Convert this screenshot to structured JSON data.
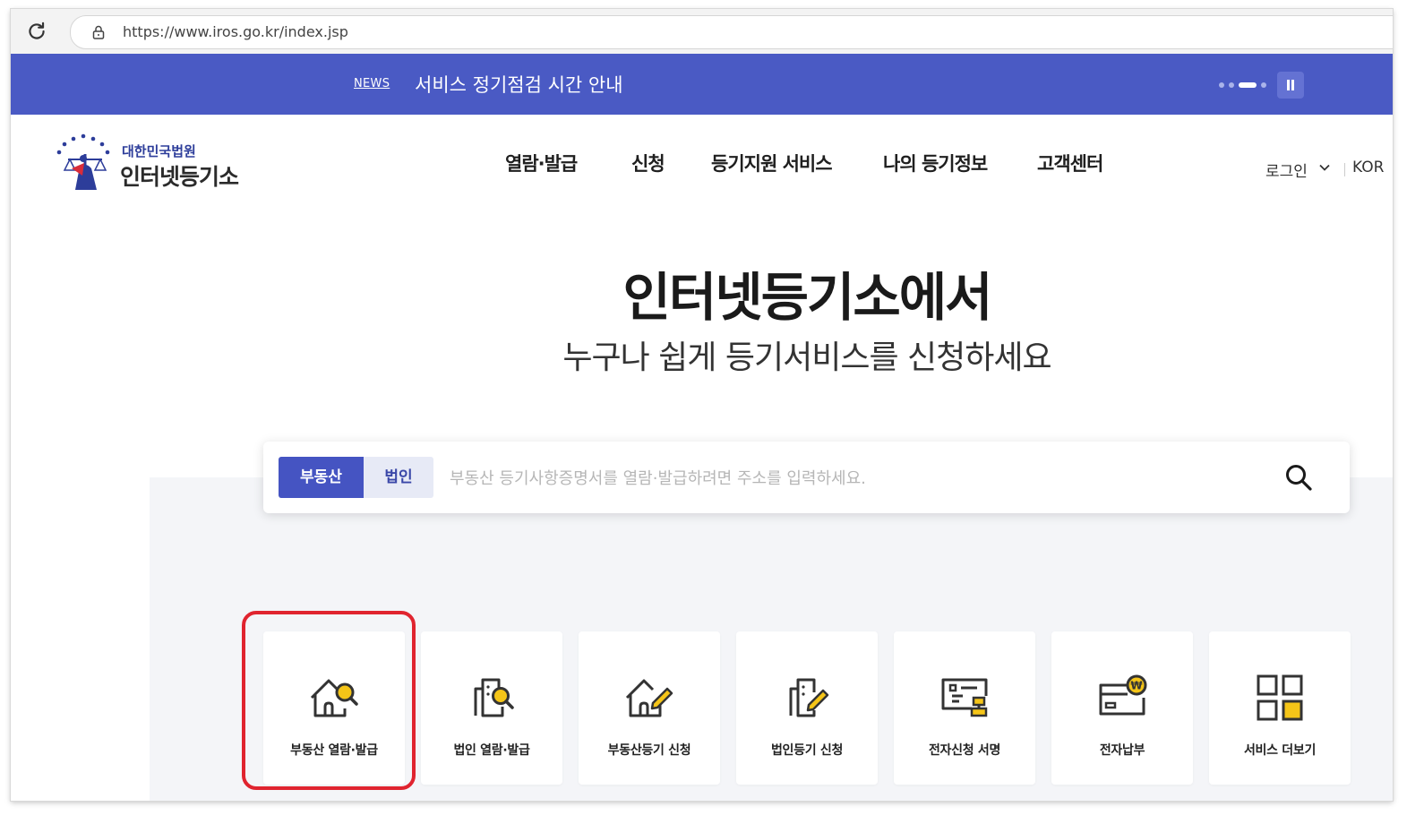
{
  "browser": {
    "url": "https://www.iros.go.kr/index.jsp"
  },
  "news": {
    "label": "NEWS",
    "text": "서비스 정기점검 시간 안내"
  },
  "header": {
    "logo_sub": "대한민국법원",
    "logo_main": "인터넷등기소",
    "nav": [
      "열람·발급",
      "신청",
      "등기지원 서비스",
      "나의 등기정보",
      "고객센터"
    ],
    "login": "로그인",
    "lang": "KOR"
  },
  "hero": {
    "title": "인터넷등기소에서",
    "subtitle": "누구나 쉽게 등기서비스를 신청하세요"
  },
  "search": {
    "tabs": [
      "부동산",
      "법인"
    ],
    "selected_tab": "부동산",
    "placeholder": "부동산 등기사항증명서를 열람·발급하려면 주소를 입력하세요."
  },
  "services": [
    {
      "label": "부동산 열람·발급",
      "icon": "house-search-icon",
      "highlighted": true
    },
    {
      "label": "법인 열람·발급",
      "icon": "building-search-icon"
    },
    {
      "label": "부동산등기 신청",
      "icon": "house-edit-icon"
    },
    {
      "label": "법인등기 신청",
      "icon": "building-edit-icon"
    },
    {
      "label": "전자신청 서명",
      "icon": "e-sign-icon"
    },
    {
      "label": "전자납부",
      "icon": "card-payment-icon"
    },
    {
      "label": "서비스 더보기",
      "icon": "grid-more-icon"
    }
  ],
  "colors": {
    "brand": "#4a5ac4",
    "accent": "#f5c518",
    "highlight": "#e0242f",
    "text": "#222222"
  }
}
